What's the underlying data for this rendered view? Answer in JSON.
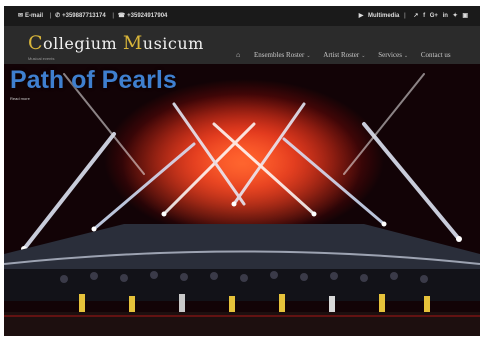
{
  "topbar": {
    "email_label": "E-mail",
    "phone1": "+359887713174",
    "phone2": "+35924917904",
    "multimedia_label": "Multimedia",
    "social_icons": [
      "share-icon",
      "facebook-icon",
      "google-plus-icon",
      "linkedin-icon",
      "twitter-icon",
      "youtube-icon"
    ]
  },
  "brand": {
    "c_letter": "C",
    "c_rest": "ollegium ",
    "m_letter": "M",
    "m_rest": "usicum",
    "tagline": "Musical events"
  },
  "nav": {
    "items": [
      {
        "label": "Ensembles Roster"
      },
      {
        "label": "Artist Roster"
      },
      {
        "label": "Services"
      },
      {
        "label": "Contact us"
      }
    ]
  },
  "hero": {
    "title": "Path of Pearls",
    "subtitle": "Read more"
  },
  "colors": {
    "accent_gold": "#d8b53a",
    "title_blue": "#3f7fcf",
    "topbar_bg": "#1a1a1a",
    "navbar_bg": "#2b2b2b"
  }
}
